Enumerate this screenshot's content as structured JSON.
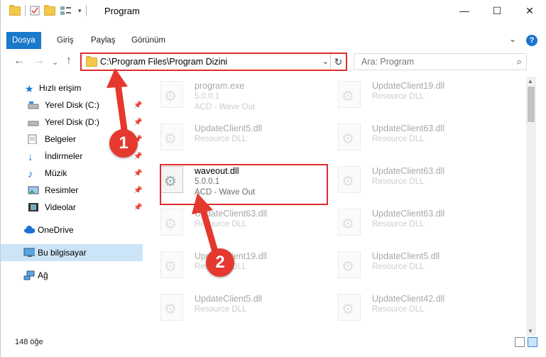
{
  "window": {
    "title": "Program",
    "minimize": "—",
    "maximize": "☐",
    "close": "✕"
  },
  "ribbon": {
    "tabs": [
      {
        "label": "Dosya"
      },
      {
        "label": "Giriş"
      },
      {
        "label": "Paylaş"
      },
      {
        "label": "Görünüm"
      }
    ],
    "help": "?",
    "collapse": "⌄"
  },
  "nav": {
    "back": "←",
    "forward": "→",
    "recent": "⌄",
    "up": "↑"
  },
  "address": {
    "path": "C:\\Program Files\\Program Dizini",
    "dropdown": "⌄",
    "refresh": "↻"
  },
  "search": {
    "placeholder": "Ara: Program",
    "icon": "⌕"
  },
  "sidebar": {
    "items": [
      {
        "label": "Hızlı erişim",
        "icon": "star-icon",
        "pinned": false
      },
      {
        "label": "Yerel Disk (C:)",
        "icon": "drive-icon",
        "pinned": true
      },
      {
        "label": "Yerel Disk (D:)",
        "icon": "drive-icon",
        "pinned": true
      },
      {
        "label": "Belgeler",
        "icon": "documents-icon",
        "pinned": true
      },
      {
        "label": "İndirmeler",
        "icon": "downloads-icon",
        "pinned": true
      },
      {
        "label": "Müzik",
        "icon": "music-icon",
        "pinned": true
      },
      {
        "label": "Resimler",
        "icon": "pictures-icon",
        "pinned": true
      },
      {
        "label": "Videolar",
        "icon": "videos-icon",
        "pinned": true
      },
      {
        "label": "OneDrive",
        "icon": "cloud-icon",
        "pinned": false
      },
      {
        "label": "Bu bilgisayar",
        "icon": "computer-icon",
        "pinned": false
      },
      {
        "label": "Ağ",
        "icon": "network-icon",
        "pinned": false
      }
    ]
  },
  "files": [
    {
      "name": "program.exe",
      "line1": "5.0.0.1",
      "line2": "ACD - Wave Out"
    },
    {
      "name": "UpdateClient19.dll",
      "line1": "Resource DLL",
      "line2": ""
    },
    {
      "name": "UpdateClient5.dll",
      "line1": "Resource DLL",
      "line2": ""
    },
    {
      "name": "UpdateClient63.dll",
      "line1": "Resource DLL",
      "line2": ""
    },
    {
      "name": "waveout.dll",
      "line1": "5.0.0.1",
      "line2": "ACD - Wave Out"
    },
    {
      "name": "UpdateClient63.dll",
      "line1": "Resource DLL",
      "line2": ""
    },
    {
      "name": "UpdateClient63.dll",
      "line1": "Resource DLL",
      "line2": ""
    },
    {
      "name": "UpdateClient63.dll",
      "line1": "Resource DLL",
      "line2": ""
    },
    {
      "name": "UpdateClient19.dll",
      "line1": "Resource DLL",
      "line2": ""
    },
    {
      "name": "UpdateClient5.dll",
      "line1": "Resource DLL",
      "line2": ""
    },
    {
      "name": "UpdateClient5.dll",
      "line1": "Resource DLL",
      "line2": ""
    },
    {
      "name": "UpdateClient42.dll",
      "line1": "Resource DLL",
      "line2": ""
    }
  ],
  "status": {
    "count": "148 öğe"
  },
  "annotations": {
    "step1": "1",
    "step2": "2",
    "color": "#e5382e"
  }
}
